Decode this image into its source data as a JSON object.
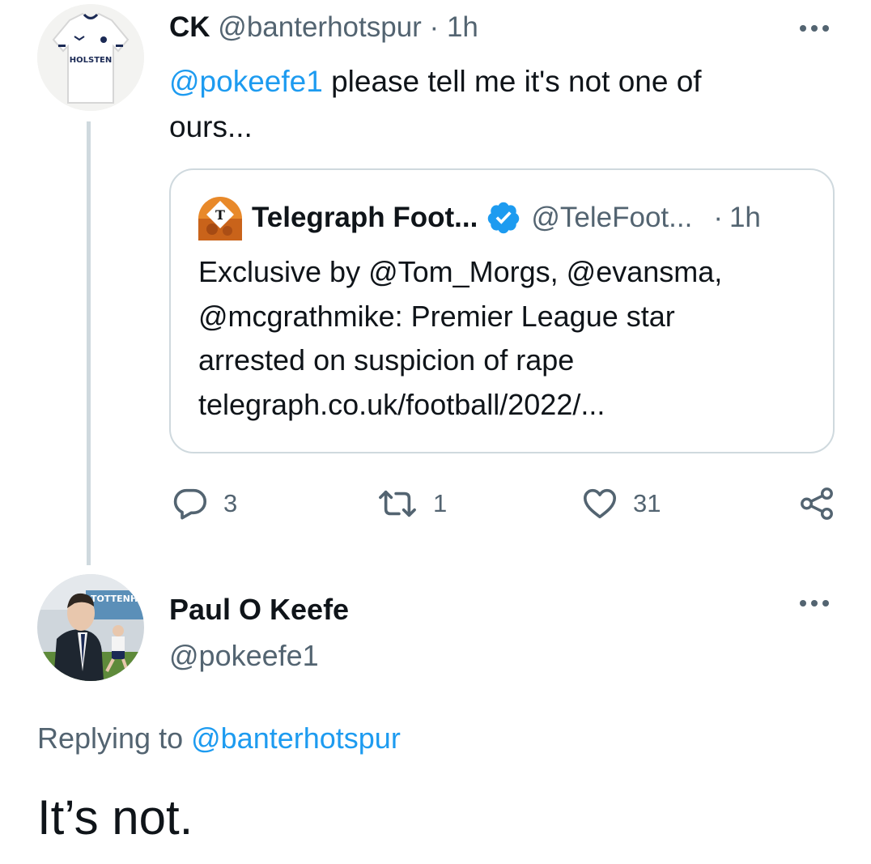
{
  "first_tweet": {
    "author_name": "CK",
    "author_handle": "@banterhotspur",
    "separator": "·",
    "time": "1h",
    "avatar_shirt_text": "HOLSTEN",
    "mention": "@pokeefe1",
    "text_line1": " please tell me it's not one of",
    "text_line2": "ours...",
    "quoted": {
      "author_name": "Telegraph Foot...",
      "author_handle": "@TeleFoot...",
      "separator": "·",
      "time": "1h",
      "verified": true,
      "lines": [
        "Exclusive by @Tom_Morgs, @evansma,",
        "@mcgrathmike: Premier League star",
        "arrested on suspicion of rape",
        "telegraph.co.uk/football/2022/..."
      ]
    },
    "actions": {
      "replies": "3",
      "retweets": "1",
      "likes": "31"
    }
  },
  "main_tweet": {
    "author_name": "Paul O Keefe",
    "author_handle": "@pokeefe1",
    "avatar_sign_text": "TOTTENH",
    "replying_label": "Replying to ",
    "replying_handle": "@banterhotspur",
    "text": "It’s not."
  },
  "colors": {
    "accent": "#1d9bf0",
    "secondary_text": "#536471",
    "border": "#cfd9de",
    "telegraph_orange": "#e8892a"
  }
}
